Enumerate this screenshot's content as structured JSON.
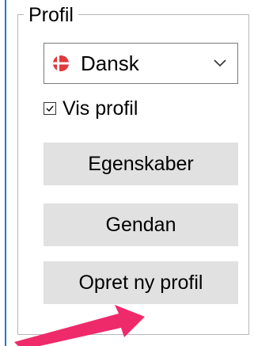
{
  "group": {
    "title": "Profil"
  },
  "language_select": {
    "selected": "Dansk",
    "flag_icon": "denmark-flag-icon",
    "chevron_icon": "chevron-down-icon"
  },
  "show_profile": {
    "label": "Vis profil",
    "checked": true
  },
  "buttons": {
    "properties": "Egenskaber",
    "restore": "Gendan",
    "create_profile": "Opret ny profil"
  },
  "colors": {
    "accent_edge": "#1e79d8",
    "arrow": "#ee2a6b",
    "button_bg": "#e1e1e1",
    "flag_red": "#e0393e"
  }
}
